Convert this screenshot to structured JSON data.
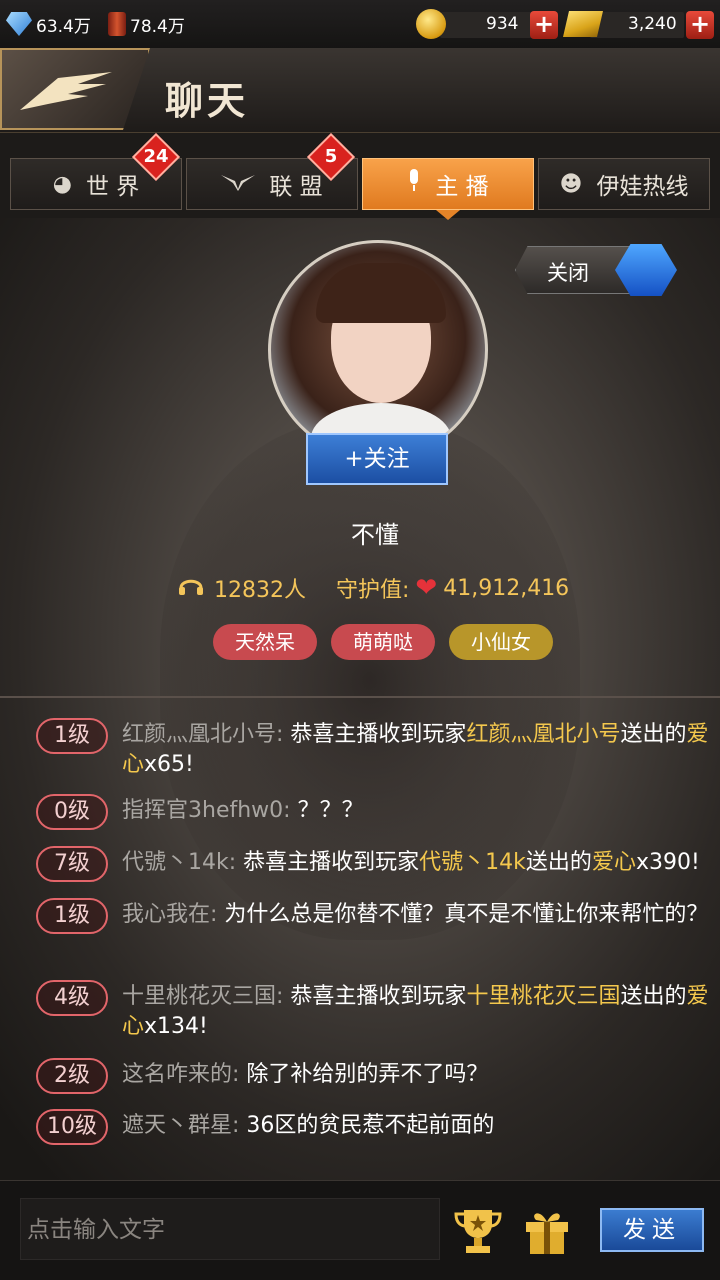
{
  "resources": {
    "gems": "63.4万",
    "oil": "78.4万",
    "coins": "934",
    "gold": "3,240"
  },
  "header": {
    "title": "聊天"
  },
  "tabs": [
    {
      "label": "世 界",
      "icon": "globe-icon",
      "badge": "24"
    },
    {
      "label": "联 盟",
      "icon": "alliance-wings-icon",
      "badge": "5"
    },
    {
      "label": "主 播",
      "icon": "microphone-icon",
      "badge": "",
      "active": true
    },
    {
      "label": "伊娃热线",
      "icon": "eva-avatar-icon",
      "badge": ""
    }
  ],
  "close_toggle": {
    "label": "关闭"
  },
  "host": {
    "follow_label": "+关注",
    "name": "不懂",
    "listeners": "12832人",
    "guard_label": "守护值:",
    "guard_value": "41,912,416",
    "tags": [
      "天然呆",
      "萌萌哒",
      "小仙女"
    ]
  },
  "colors": {
    "accent_orange": "#e07a1f",
    "tag_red": "#c84a4f",
    "tag_gold": "#b8962a",
    "highlight": "#f4c84d"
  },
  "messages": [
    {
      "level": "1级",
      "user": "红颜灬凰北小号:",
      "text": "恭喜主播收到玩家",
      "hl1": "红颜灬凰北小号",
      "text2": "送出的",
      "hl2": "爱心",
      "text3": "x65!"
    },
    {
      "level": "0级",
      "user": "指挥官3hefhw0:",
      "text": "？？？"
    },
    {
      "level": "7级",
      "user": "代號丶14k:",
      "text": "恭喜主播收到玩家",
      "hl1": "代號丶14k",
      "text2": "送出的",
      "hl2": "爱心",
      "text3": "x390!"
    },
    {
      "level": "1级",
      "user": "我心我在:",
      "text": "为什么总是你替不懂？真不是不懂让你来帮忙的？"
    },
    {
      "level": "4级",
      "user": "十里桃花灭三国:",
      "text": "恭喜主播收到玩家",
      "hl1": "十里桃花灭三国",
      "text2": "送出的",
      "hl2": "爱心",
      "text3": "x134!"
    },
    {
      "level": "2级",
      "user": "这名咋来的:",
      "text": "除了补给别的弄不了吗？"
    },
    {
      "level": "10级",
      "user": "遮天丶群星:",
      "text": "36区的贫民惹不起前面的"
    }
  ],
  "input": {
    "placeholder": "点击输入文字"
  },
  "send_label": "发送"
}
